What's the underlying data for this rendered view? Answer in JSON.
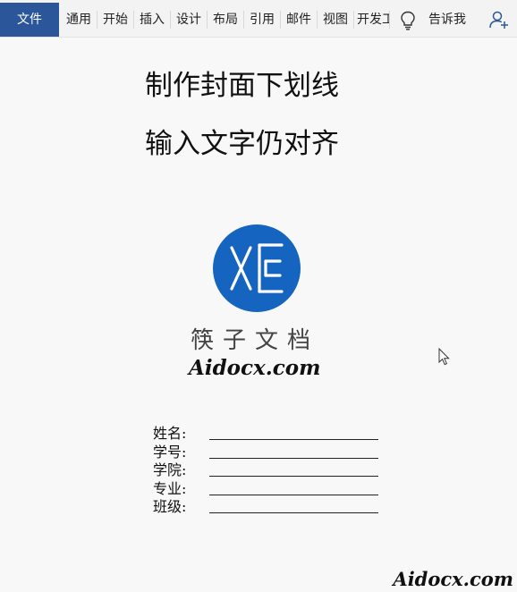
{
  "ribbon": {
    "file_tab": "文件",
    "tabs": [
      {
        "label": "通用"
      },
      {
        "label": "开始"
      },
      {
        "label": "插入"
      },
      {
        "label": "设计"
      },
      {
        "label": "布局"
      },
      {
        "label": "引用"
      },
      {
        "label": "邮件"
      },
      {
        "label": "视图"
      },
      {
        "label": "开发工"
      }
    ],
    "tell_me_icon": "lightbulb-icon",
    "tell_me_label": "告诉我",
    "share_icon": "add-person-icon",
    "accent_color": "#2b579a"
  },
  "document": {
    "heading_1": "制作封面下划线",
    "heading_2": "输入文字仍对齐",
    "logo": {
      "icon": "xe-circle-logo",
      "cn_text": "筷子文档",
      "en_text": "Aidocx.com",
      "color": "#1565c0"
    },
    "form_fields": [
      {
        "label": "姓名:"
      },
      {
        "label": "学号:"
      },
      {
        "label": "学院:"
      },
      {
        "label": "专业:"
      },
      {
        "label": "班级:"
      }
    ],
    "watermark": "Aidocx.com"
  }
}
